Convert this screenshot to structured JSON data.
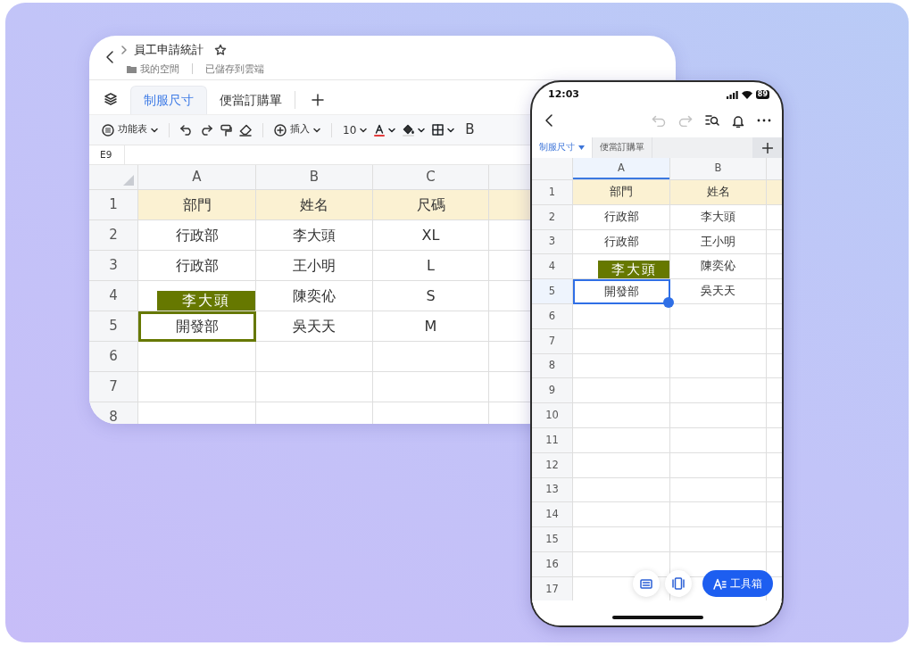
{
  "tablet": {
    "title": "員工申請統計",
    "location": "我的空間",
    "save_status": "已儲存到雲端",
    "sheet_tabs": [
      {
        "label": "制服尺寸",
        "selected": true
      },
      {
        "label": "便當訂購單",
        "selected": false
      }
    ],
    "toolbar": {
      "menu": "功能表",
      "insert": "插入",
      "font_size": "10",
      "bold": "B"
    },
    "cell_ref": "E9",
    "columns": [
      "A",
      "B",
      "C"
    ],
    "collaborator": {
      "name": "李大頭",
      "color": "#667800"
    },
    "rows": [
      {
        "number": "1",
        "kind": "header",
        "cells": [
          {
            "text": "部門",
            "selected": false
          },
          {
            "text": "姓名",
            "selected": false
          },
          {
            "text": "尺碼",
            "selected": false
          }
        ]
      },
      {
        "number": "2",
        "kind": "data",
        "cells": [
          {
            "text": "行政部",
            "selected": false
          },
          {
            "text": "李大頭",
            "selected": false
          },
          {
            "text": "XL",
            "selected": false
          }
        ]
      },
      {
        "number": "3",
        "kind": "data",
        "cells": [
          {
            "text": "行政部",
            "selected": false
          },
          {
            "text": "王小明",
            "selected": false
          },
          {
            "text": "L",
            "selected": false
          }
        ]
      },
      {
        "number": "4",
        "kind": "data",
        "cells": [
          {
            "selected": false
          },
          {
            "text": "陳奕伈",
            "selected": false
          },
          {
            "text": "S",
            "selected": false
          }
        ]
      },
      {
        "number": "5",
        "kind": "data",
        "cells": [
          {
            "text": "開發部",
            "selected": true
          },
          {
            "text": "吳天天",
            "selected": false
          },
          {
            "text": "M",
            "selected": false
          }
        ]
      },
      {
        "number": "6",
        "kind": "data"
      },
      {
        "number": "7",
        "kind": "data"
      },
      {
        "number": "8",
        "kind": "data"
      }
    ]
  },
  "phone": {
    "time": "12:03",
    "battery": "89",
    "sheet_tabs": [
      {
        "label": "制服尺寸",
        "selected": true
      },
      {
        "label": "便當訂購單",
        "selected": false
      }
    ],
    "columns": [
      "A",
      "B"
    ],
    "collaborator": {
      "name": "李大頭",
      "color": "#667800"
    },
    "rows": [
      {
        "number": "1",
        "kind": "header",
        "cells": [
          {
            "text": "部門",
            "selected": false
          },
          {
            "text": "姓名",
            "selected": false
          }
        ]
      },
      {
        "number": "2",
        "kind": "data",
        "cells": [
          {
            "text": "行政部",
            "selected": false
          },
          {
            "text": "李大頭",
            "selected": false
          }
        ]
      },
      {
        "number": "3",
        "kind": "data",
        "cells": [
          {
            "text": "行政部",
            "selected": false
          },
          {
            "text": "王小明",
            "selected": false
          }
        ]
      },
      {
        "number": "4",
        "kind": "data",
        "cells": [
          {
            "selected": false
          },
          {
            "text": "陳奕伈",
            "selected": false
          }
        ]
      },
      {
        "number": "5",
        "kind": "data",
        "cells": [
          {
            "text": "開發部",
            "selected": true
          },
          {
            "text": "吳天天",
            "selected": false
          }
        ]
      },
      {
        "number": "6",
        "kind": "data"
      },
      {
        "number": "7",
        "kind": "data"
      },
      {
        "number": "8",
        "kind": "data"
      },
      {
        "number": "9",
        "kind": "data"
      },
      {
        "number": "10",
        "kind": "data"
      },
      {
        "number": "11",
        "kind": "data"
      },
      {
        "number": "12",
        "kind": "data"
      },
      {
        "number": "13",
        "kind": "data"
      },
      {
        "number": "14",
        "kind": "data"
      },
      {
        "number": "15",
        "kind": "data"
      },
      {
        "number": "16",
        "kind": "data"
      },
      {
        "number": "17",
        "kind": "data"
      }
    ],
    "toolbox_button": "工具箱"
  }
}
